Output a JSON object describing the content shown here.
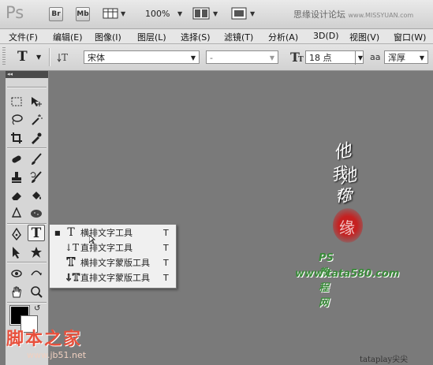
{
  "app": {
    "logo": "Ps",
    "bridge_label": "Br",
    "minibridge_label": "Mb",
    "zoom": "100%",
    "brand_text": "思缘设计论坛",
    "brand_url": "www.MISSYUAN.com"
  },
  "menu": [
    "文件(F)",
    "编辑(E)",
    "图像(I)",
    "图层(L)",
    "选择(S)",
    "滤镜(T)",
    "分析(A)",
    "3D(D)",
    "视图(V)",
    "窗口(W)"
  ],
  "options": {
    "tool_icon": "T",
    "font_family": "宋体",
    "font_style": "-",
    "font_size": "18 点",
    "aa_icon": "aa",
    "antialias": "浑厚"
  },
  "toolbox": {
    "collapse": "◂◂"
  },
  "flyout": {
    "items": [
      {
        "icon": "T",
        "label": "横排文字工具",
        "key": "T",
        "selected": true
      },
      {
        "icon": "↓T",
        "label": "直排文字工具",
        "key": "T",
        "selected": false
      },
      {
        "icon": "T",
        "label": "横排文字蒙版工具",
        "key": "T",
        "selected": false
      },
      {
        "icon": "↓T",
        "label": "直排文字蒙版工具",
        "key": "T",
        "selected": false
      }
    ]
  },
  "artwork": {
    "calligraphy_1": "他她",
    "calligraphy_2": "我帮",
    "calligraphy_3": "你",
    "seal": "缘",
    "tutorial_label": "PS教程网",
    "tutorial_url": "www.tata580.com"
  },
  "overlays": {
    "watermark": "脚本之家",
    "watermark_url": "www.jb51.net",
    "corner_mark": "tataplay尖尖"
  },
  "colors": {
    "canvas": "#7a7a7a",
    "foreground": "#000000",
    "background": "#ffffff",
    "watermark": "#e8503c",
    "tutorial_green": "#3a8a3a",
    "seal_red": "#c62020"
  }
}
